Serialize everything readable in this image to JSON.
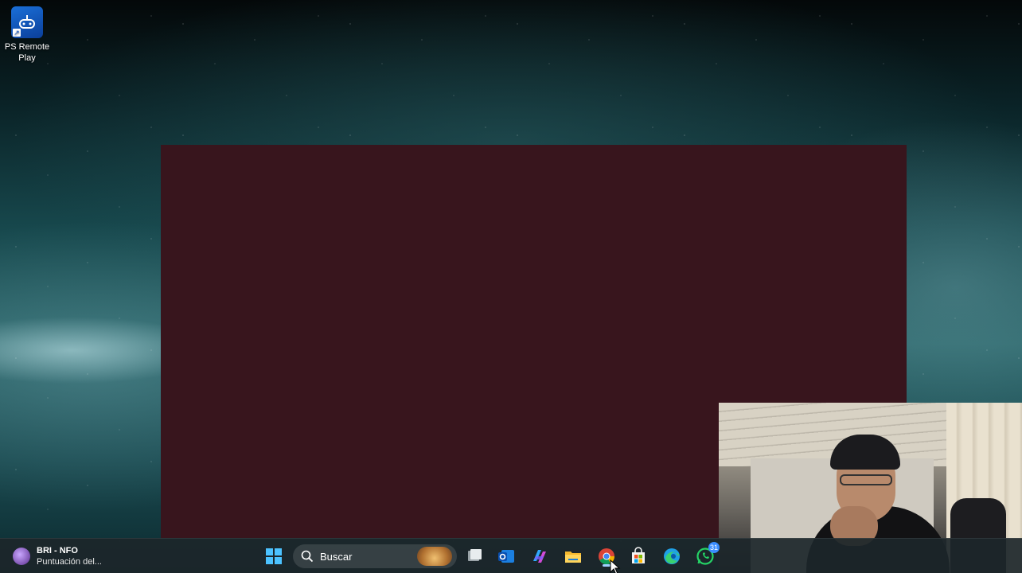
{
  "desktop": {
    "icons": [
      {
        "label": "PS Remote Play",
        "icon": "ps-remote-play-icon"
      }
    ]
  },
  "window": {
    "background_color": "#38151d"
  },
  "taskbar": {
    "widget": {
      "line1": "BRI - NFO",
      "line2": "Puntuación del..."
    },
    "search": {
      "placeholder": "Buscar"
    },
    "apps": [
      {
        "name": "Windows Start",
        "icon": "windows-start-icon"
      },
      {
        "name": "Task View",
        "icon": "task-view-icon"
      },
      {
        "name": "Outlook",
        "icon": "outlook-icon"
      },
      {
        "name": "Microsoft 365 Copilot",
        "icon": "copilot-icon"
      },
      {
        "name": "File Explorer",
        "icon": "folder-icon"
      },
      {
        "name": "Google Chrome",
        "icon": "chrome-icon",
        "active": true
      },
      {
        "name": "Microsoft Store",
        "icon": "store-icon"
      },
      {
        "name": "Microsoft Edge",
        "icon": "edge-icon"
      },
      {
        "name": "WhatsApp",
        "icon": "whatsapp-icon",
        "badge": "31"
      }
    ]
  },
  "colors": {
    "taskbar": "#1c262a",
    "accent": "#3a8dff"
  }
}
